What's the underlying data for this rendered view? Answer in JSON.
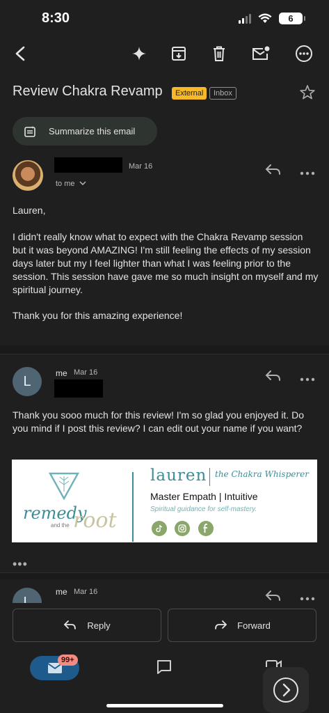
{
  "status_bar": {
    "time": "8:30",
    "battery": "6"
  },
  "subject": "Review Chakra Revamp",
  "labels": {
    "external": "External",
    "inbox": "Inbox"
  },
  "summarize_label": "Summarize this email",
  "message1": {
    "date": "Mar 16",
    "to_me": "to me",
    "greeting": "Lauren,",
    "paragraph1": "I didn't really know what to expect with the Chakra Revamp session but it was beyond  AMAZING! I'm still feeling the effects of my session days later but my I feel lighter than what I was feeling prior to the session. This session have gave me so much insight on myself and my spiritual journey.",
    "paragraph2": "Thank you for this amazing experience!"
  },
  "message2": {
    "avatar_letter": "L",
    "sender": "me",
    "date": "Mar 16",
    "body": "Thank you sooo much for this review! I'm so glad you enjoyed it. Do you mind if I post this review? I can edit out your name if you want?"
  },
  "signature": {
    "brand_word1": "remedy",
    "brand_small": "and the",
    "brand_word2": "root",
    "name": "lauren",
    "script_title": "the Chakra Whisperer",
    "role": "Master Empath | Intuitive",
    "tagline": "Spiritual guidance for self-mastery."
  },
  "message3": {
    "avatar_letter": "L",
    "sender": "me",
    "date": "Mar 16"
  },
  "buttons": {
    "reply": "Reply",
    "forward": "Forward"
  },
  "nav": {
    "badge": "99+"
  }
}
